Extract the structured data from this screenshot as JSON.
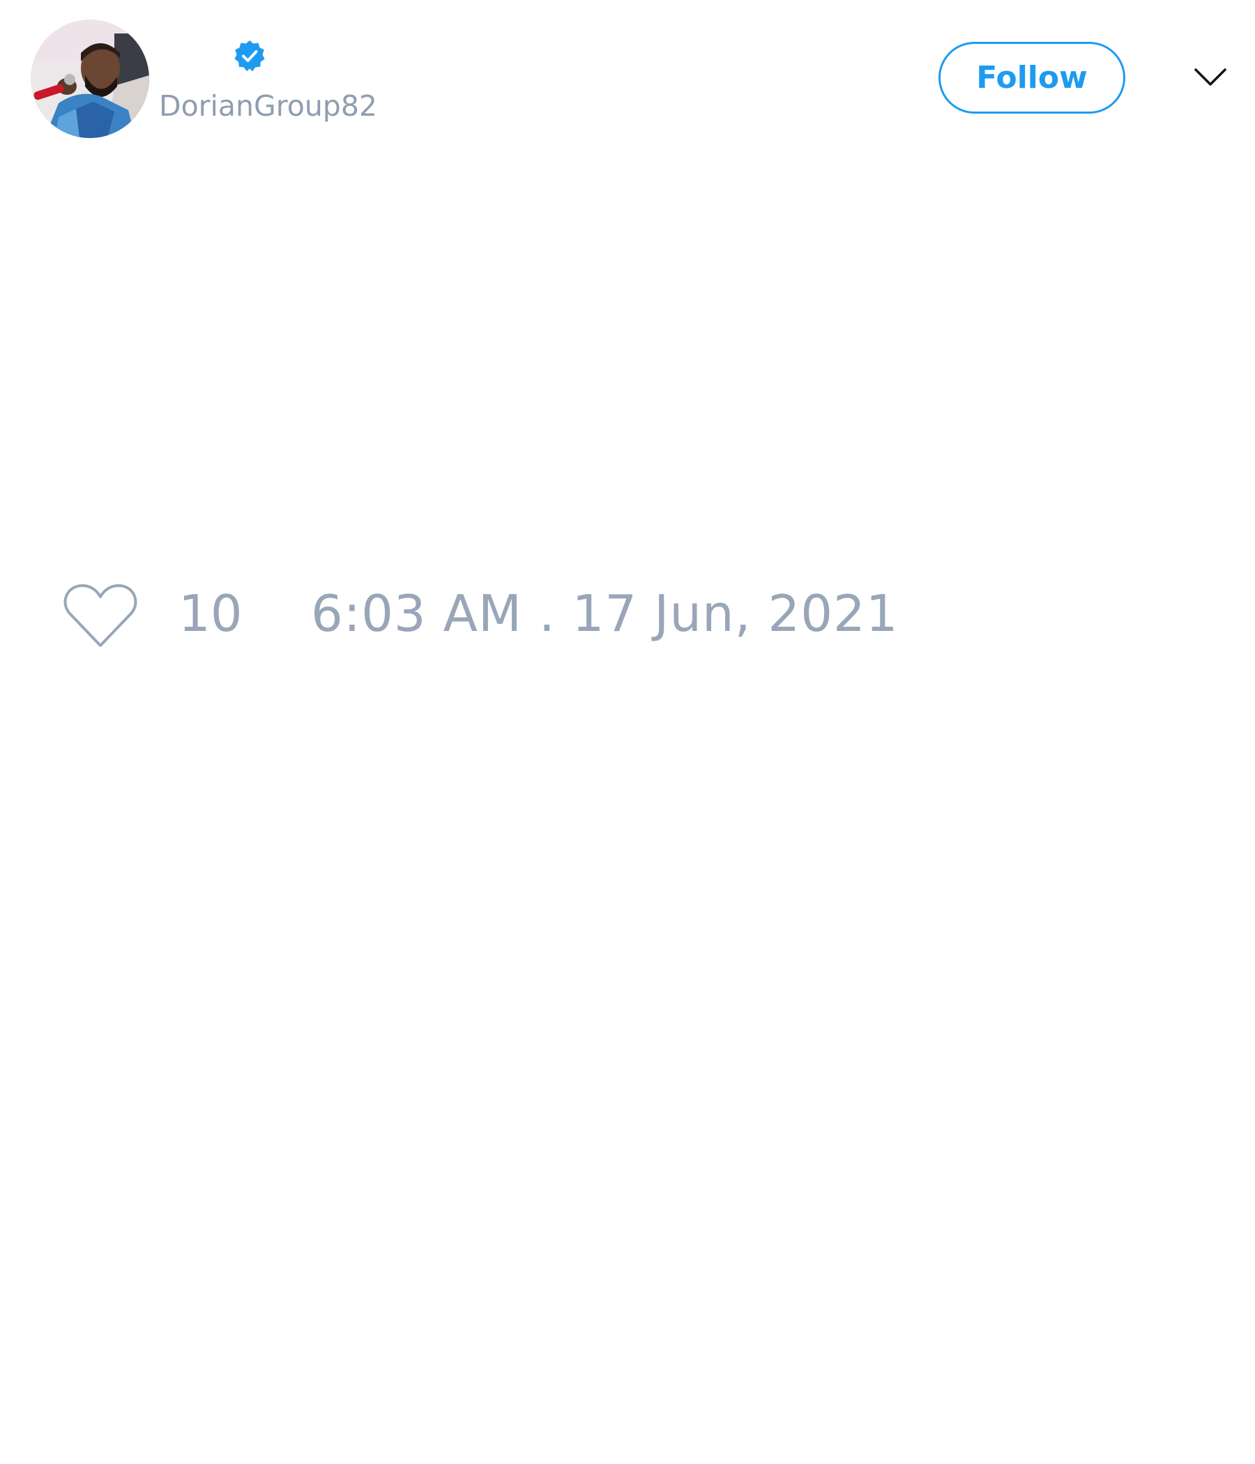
{
  "tweet": {
    "author": {
      "handle": "DorianGroup82",
      "verified": true,
      "avatar": "profile-photo"
    },
    "follow_label": "Follow",
    "menu_icon": "chevron-down-icon",
    "like_icon": "heart-outline-icon",
    "like_count": "10",
    "timestamp": "6:03 AM . 17 Jun, 2021"
  },
  "colors": {
    "accent": "#1d9bf0",
    "muted_text": "#98a6b8",
    "background": "#ffffff"
  }
}
